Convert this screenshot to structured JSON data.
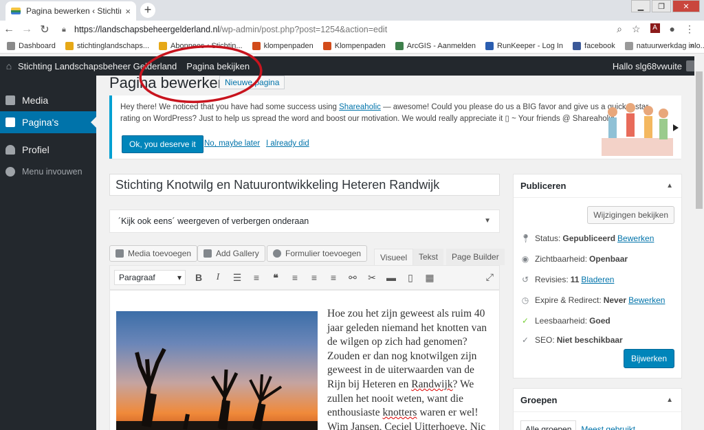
{
  "browser": {
    "tab_title": "Pagina bewerken ‹ Stichting Land",
    "tab_close": "×",
    "new_tab": "+",
    "window_controls": [
      "▁",
      "❐",
      "✕"
    ],
    "url_host": "https://landschapsbeheergelderland.nl",
    "url_path": "/wp-admin/post.php?post=1254&action=edit",
    "bookmarks": [
      {
        "label": "Dashboard",
        "color": "#8a8a8a"
      },
      {
        "label": "stichtinglandschaps...",
        "color": "#e6a817"
      },
      {
        "label": "Abonnees ‹ Stichtin...",
        "color": "#e6a817"
      },
      {
        "label": "klompenpaden",
        "color": "#d24b1a"
      },
      {
        "label": "Klompenpaden",
        "color": "#d24b1a"
      },
      {
        "label": "ArcGIS - Aanmelden",
        "color": "#3d7f4b"
      },
      {
        "label": "RunKeeper - Log In",
        "color": "#2a5db0"
      },
      {
        "label": "facebook",
        "color": "#3b5998"
      },
      {
        "label": "natuurwerkdag inlo...",
        "color": "#999999"
      }
    ],
    "bookmarks_more": "»"
  },
  "adminbar": {
    "site_name": "Stichting Landschapsbeheer Gelderland",
    "view_page": "Pagina bekijken",
    "howdy": "Hallo slg68vwuite"
  },
  "sidebar": {
    "items": [
      {
        "label": "Media",
        "icon": "media-icon"
      },
      {
        "label": "Pagina's",
        "icon": "pages-icon",
        "current": true
      },
      {
        "label": "Profiel",
        "icon": "profile-icon"
      },
      {
        "label": "Menu invouwen",
        "icon": "collapse-icon"
      }
    ]
  },
  "page": {
    "heading": "Pagina bewerken",
    "new_page": "Nieuwe pagina"
  },
  "notice": {
    "text_before": "Hey there! We noticed that you have had some success using ",
    "link": "Shareaholic",
    "text_after": " — awesome! Could you please do us a BIG favor and give us a quick 5-star rating on WordPress? Just to help us spread the word and boost our motivation. We would really appreciate it ▯ ~ Your friends @ Shareaholic",
    "ok_button": "Ok, you deserve it",
    "maybe_later": "No, maybe later",
    "already_did": "I already did"
  },
  "editor": {
    "title_value": "Stichting Knotwilg en Natuurontwikkeling Heteren Randwijk",
    "kijk_box": "´Kijk ook eens´ weergeven of verbergen onderaan",
    "media_buttons": [
      "Media toevoegen",
      "Add Gallery",
      "Formulier toevoegen"
    ],
    "tabs": [
      "Visueel",
      "Tekst",
      "Page Builder"
    ],
    "format_select": "Paragraaf",
    "body_parts": [
      "Hoe zou het zijn geweest als ruim 40 jaar geleden niemand het knotten van de wilgen op zich had genomen? Zouden er dan nog knotwilgen zijn geweest in de uiterwaarden van de Rijn bij Heteren en ",
      "Randwijk",
      "? We zullen het nooit weten, want die enthousiaste ",
      "knotters",
      " waren er wel! Wim Jansen, Ceciel Uitterhoeve, Nic"
    ]
  },
  "publish": {
    "title": "Publiceren",
    "preview_changes": "Wijzigingen bekijken",
    "rows": [
      {
        "label": "Status:",
        "value": "Gepubliceerd",
        "link": "Bewerken",
        "icon": "pin-icon"
      },
      {
        "label": "Zichtbaarheid:",
        "value": "Openbaar",
        "link": "",
        "icon": "eye-icon"
      },
      {
        "label": "Revisies:",
        "value": "11",
        "link": "Bladeren",
        "icon": "revisions-icon"
      },
      {
        "label": "Expire & Redirect:",
        "value": "Never",
        "link": "Bewerken",
        "icon": "clock-icon"
      },
      {
        "label": "Leesbaarheid:",
        "value": "Goed",
        "link": "",
        "icon": "yoast-readability-icon"
      },
      {
        "label": "SEO:",
        "value": "Niet beschikbaar",
        "link": "",
        "icon": "yoast-seo-icon"
      }
    ],
    "update_button": "Bijwerken"
  },
  "groups": {
    "title": "Groepen",
    "tab_all": "Alle groepen",
    "tab_most": "Meest gebruikt"
  },
  "colors": {
    "wp_dark": "#23282d",
    "wp_blue": "#0073aa",
    "button_blue": "#0085ba",
    "annotation_red": "#c8141e"
  }
}
